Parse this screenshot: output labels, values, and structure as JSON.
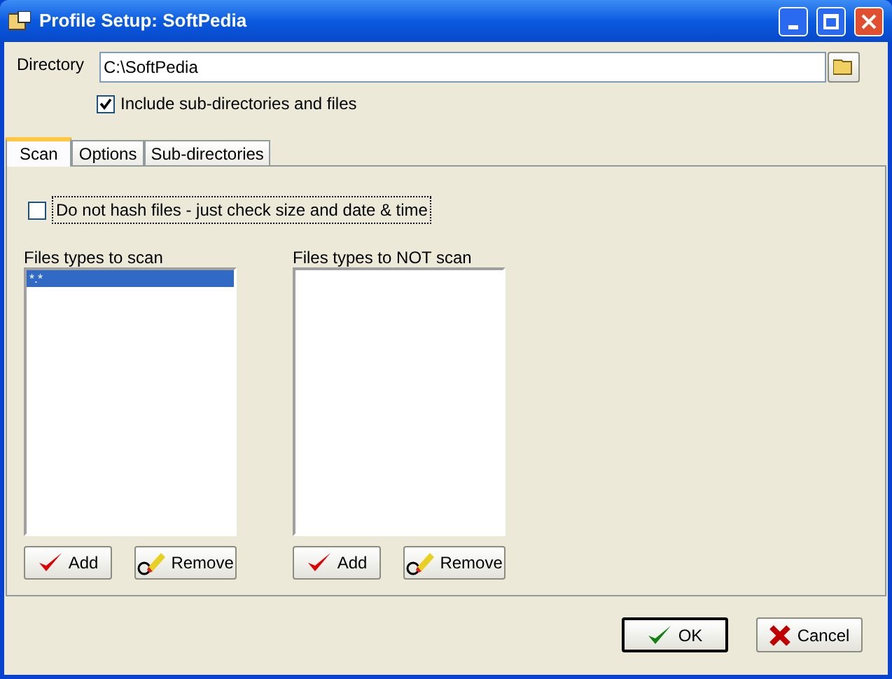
{
  "window": {
    "title": "Profile Setup: SoftPedia"
  },
  "directory": {
    "label": "Directory",
    "value": "C:\\SoftPedia"
  },
  "include_subdirs": {
    "label": "Include sub-directories and files",
    "checked": true
  },
  "tabs": [
    {
      "label": "Scan",
      "selected": true
    },
    {
      "label": "Options",
      "selected": false
    },
    {
      "label": "Sub-directories",
      "selected": false
    }
  ],
  "no_hash": {
    "label": "Do not hash files - just check size and date & time",
    "checked": false
  },
  "lists": [
    {
      "label": "Files types to scan",
      "items": [
        {
          "text": "*.*",
          "selected": true
        }
      ],
      "add": "Add",
      "remove": "Remove"
    },
    {
      "label": "Files types to NOT scan",
      "add": "Add",
      "remove": "Remove"
    }
  ],
  "buttons": {
    "ok": "OK",
    "cancel": "Cancel"
  }
}
